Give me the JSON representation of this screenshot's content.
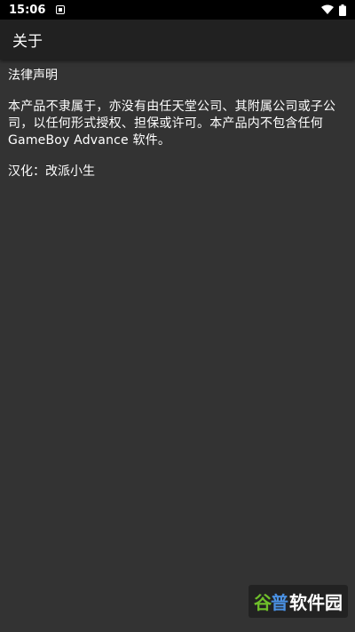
{
  "status_bar": {
    "time": "15:06"
  },
  "app_bar": {
    "title": "关于"
  },
  "content": {
    "section_title": "法律声明",
    "disclaimer": "本产品不隶属于，亦没有由任天堂公司、其附属公司或子公司，以任何形式授权、担保或许可。本产品内不包含任何 GameBoy Advance 软件。",
    "credit": "汉化：改派小生"
  },
  "watermark": {
    "logo_part1": "谷",
    "logo_part2": "普",
    "text": "软件园"
  },
  "colors": {
    "background": "#333333",
    "app_bar": "#212121",
    "status_bar": "#000000",
    "text": "#ffffff",
    "watermark_green": "#6fbf2a",
    "watermark_blue": "#4a90e2"
  }
}
